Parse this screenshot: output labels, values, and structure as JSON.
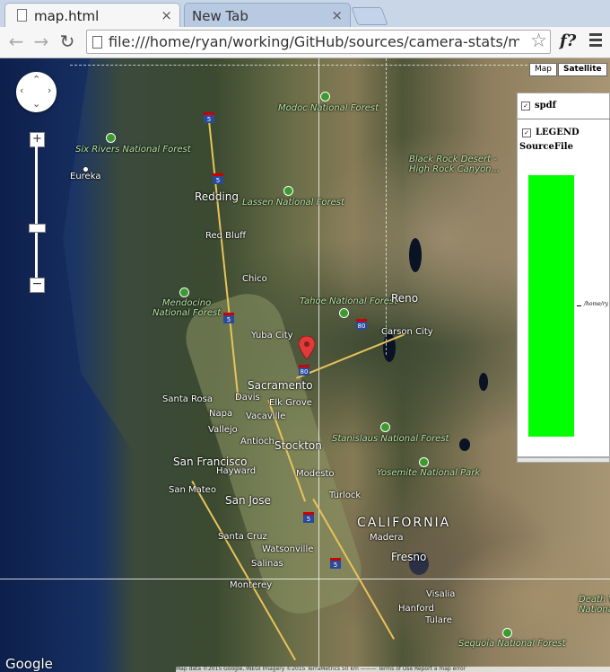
{
  "browser": {
    "tabs": [
      {
        "label": "map.html",
        "active": true
      },
      {
        "label": "New Tab",
        "active": false
      }
    ],
    "close_glyph": "×",
    "url": "file:///home/ryan/working/GitHub/sources/camera-stats/m",
    "extension_label": "f?",
    "nav": {
      "back": "←",
      "forward": "→",
      "reload": "↻"
    },
    "star_glyph": "☆"
  },
  "map": {
    "controls": {
      "zoom_in": "+",
      "zoom_out": "−",
      "map_type_buttons": [
        {
          "label": "Map",
          "selected": false
        },
        {
          "label": "Satellite",
          "selected": true
        }
      ]
    },
    "labels": {
      "modoc": "Modoc National Forest",
      "six_rivers": "Six Rivers National Forest",
      "eureka": "Eureka",
      "redding": "Redding",
      "lassen": "Lassen National Forest",
      "red_bluff": "Red Bluff",
      "chico": "Chico",
      "mendocino": "Mendocino\nNational Forest",
      "tahoe": "Tahoe National Forest",
      "reno": "Reno",
      "carson_city": "Carson City",
      "yuba_city": "Yuba City",
      "sacramento": "Sacramento",
      "davis": "Davis",
      "elk_grove": "Elk Grove",
      "santa_rosa": "Santa Rosa",
      "napa": "Napa",
      "vacaville": "Vacaville",
      "vallejo": "Vallejo",
      "antioch": "Antioch",
      "stockton": "Stockton",
      "san_francisco": "San Francisco",
      "hayward": "Hayward",
      "modesto": "Modesto",
      "san_mateo": "San Mateo",
      "san_jose": "San Jose",
      "turlock": "Turlock",
      "stanislaus": "Stanislaus National Forest",
      "yosemite": "Yosemite National Park",
      "california": "CALIFORNIA",
      "madera": "Madera",
      "santa_cruz": "Santa Cruz",
      "watsonville": "Watsonville",
      "fresno": "Fresno",
      "salinas": "Salinas",
      "monterey": "Monterey",
      "visalia": "Visalia",
      "hanford": "Hanford",
      "tulare": "Tulare",
      "death_valley": "Death V\nNationa",
      "sequoia": "Sequoia National Forest",
      "black_rock": "Black Rock Desert -\nHigh Rock Canyon..."
    },
    "shields": {
      "i5": "5",
      "i80": "80"
    },
    "layers_panel": {
      "layer_name": "spdf",
      "legend_label": "LEGEND",
      "legend_field": "SourceFile",
      "legend_entry": "/home/ry",
      "legend_color": "#00ff00"
    },
    "google_logo": "Google",
    "attribution": "Map data ©2015 Google, INEGI Imagery ©2015 TerraMetrics   50 km ———   Terms of Use   Report a map error"
  },
  "colors": {
    "tabstrip": "#c9d6e8",
    "legend": "#00ff00",
    "pin": "#e03a3a"
  }
}
